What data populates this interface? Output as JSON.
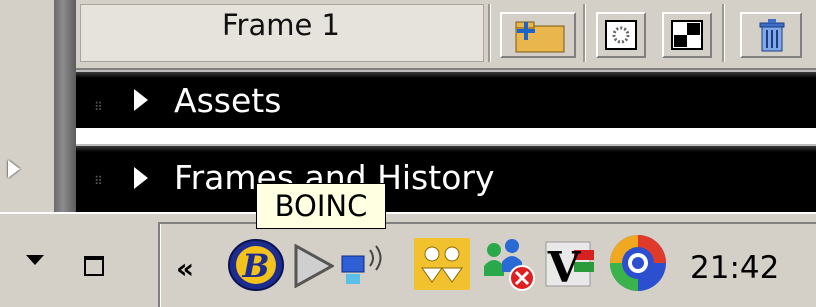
{
  "frame_panel": {
    "label": "Frame 1",
    "toolbar": {
      "import_icon": "folder-add-icon",
      "onion_skin_icon": "onion-skin-icon",
      "checker_icon": "checkerboard-icon",
      "delete_icon": "trash-icon"
    }
  },
  "panels": [
    {
      "title": "Assets",
      "icon": "expand-triangle-icon"
    },
    {
      "title": "Frames and History",
      "icon": "expand-triangle-icon"
    }
  ],
  "tooltip": {
    "text": "BOINC"
  },
  "taskbar": {
    "tray": {
      "show_hidden_label": "«",
      "icons": [
        "boinc-icon",
        "play-icon",
        "network-icon",
        "users-sync-icon",
        "messenger-offline-icon",
        "virus-shield-icon",
        "swirl-app-icon"
      ],
      "clock": "21:42"
    }
  },
  "colors": {
    "panel_bg": "#000000",
    "chrome_bg": "#d4d0c8",
    "tooltip_bg": "#ffffe1"
  }
}
